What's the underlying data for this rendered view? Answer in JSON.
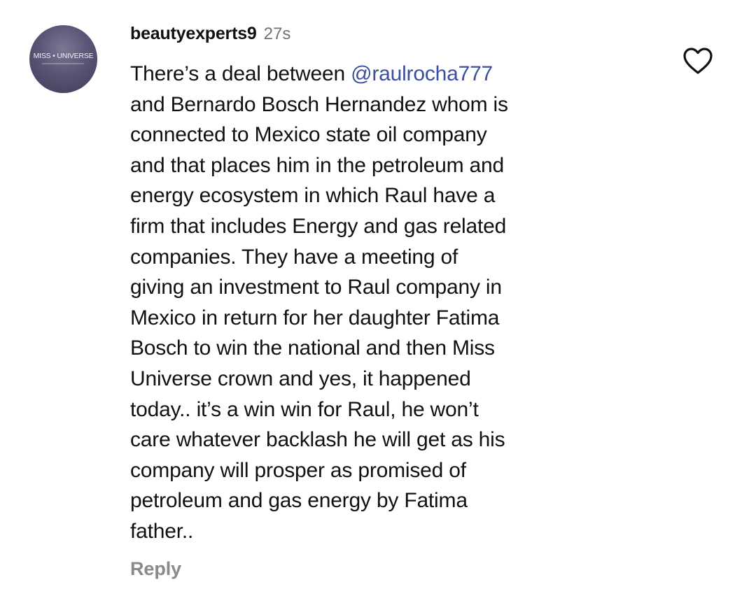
{
  "comment": {
    "avatar_label": "MISS • UNIVERSE",
    "username": "beautyexperts9",
    "timestamp": "27s",
    "text_lines": [
      {
        "before": "There’s a deal between ",
        "mention": "@raulrocha777",
        "after": ""
      },
      {
        "before": "and Bernardo Bosch Hernandez whom is",
        "mention": "",
        "after": ""
      },
      {
        "before": "connected to Mexico state oil company",
        "mention": "",
        "after": ""
      },
      {
        "before": "and that places him in the petroleum and",
        "mention": "",
        "after": ""
      },
      {
        "before": "energy ecosystem in which Raul have a",
        "mention": "",
        "after": ""
      },
      {
        "before": "firm that includes Energy and gas related",
        "mention": "",
        "after": ""
      },
      {
        "before": "companies. They have a meeting of",
        "mention": "",
        "after": ""
      },
      {
        "before": "giving an investment to Raul company in",
        "mention": "",
        "after": ""
      },
      {
        "before": "Mexico in return for her daughter Fatima",
        "mention": "",
        "after": ""
      },
      {
        "before": "Bosch to win the national and then Miss",
        "mention": "",
        "after": ""
      },
      {
        "before": "Universe crown and yes, it happened",
        "mention": "",
        "after": ""
      },
      {
        "before": "today.. it’s a win win for Raul, he won’t",
        "mention": "",
        "after": ""
      },
      {
        "before": "care whatever backlash he will get as his",
        "mention": "",
        "after": ""
      },
      {
        "before": "company will prosper as promised of",
        "mention": "",
        "after": ""
      },
      {
        "before": "petroleum and gas energy by Fatima",
        "mention": "",
        "after": ""
      },
      {
        "before": "father..",
        "mention": "",
        "after": ""
      }
    ],
    "reply_label": "Reply",
    "like_icon": "heart-outline-icon"
  },
  "colors": {
    "mention": "#3c4e9e",
    "muted": "#737373",
    "text": "#111111"
  }
}
